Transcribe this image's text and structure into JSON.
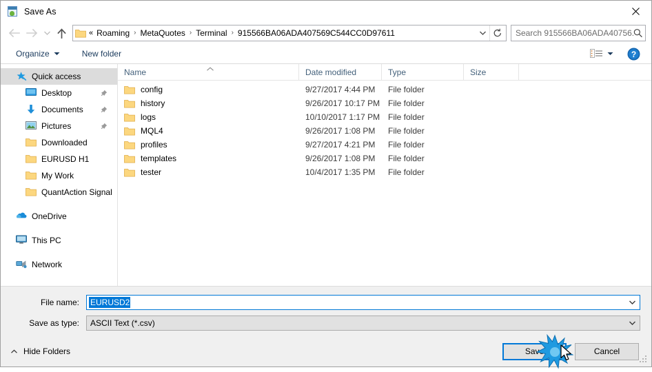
{
  "window": {
    "title": "Save As",
    "icon": "save-as-icon",
    "close_label": "✕"
  },
  "navigation": {
    "back_icon": "back-arrow-icon",
    "forward_icon": "forward-arrow-icon",
    "recent_icon": "recent-locations-icon",
    "up_icon": "up-arrow-icon",
    "breadcrumb_prefix": "«",
    "breadcrumbs": [
      "Roaming",
      "MetaQuotes",
      "Terminal",
      "915566BA06ADA407569C544CC0D97611"
    ],
    "separator": "›",
    "dropdown_icon": "chevron-down-icon",
    "refresh_icon": "refresh-icon"
  },
  "search": {
    "placeholder": "Search 915566BA06ADA40756...",
    "icon": "search-icon"
  },
  "toolbar": {
    "organize_label": "Organize",
    "organize_caret": "caret-down-icon",
    "new_folder_label": "New folder",
    "view_icon": "view-options-icon",
    "view_caret": "caret-down-icon",
    "help_icon": "help-icon",
    "help_glyph": "?"
  },
  "sidebar": {
    "groups": [
      {
        "items": [
          {
            "label": "Quick access",
            "icon": "star-pin-icon",
            "selected": true,
            "level": 0,
            "pinned": false
          },
          {
            "label": "Desktop",
            "icon": "desktop-icon",
            "selected": false,
            "level": 1,
            "pinned": true
          },
          {
            "label": "Documents",
            "icon": "documents-icon",
            "selected": false,
            "level": 1,
            "pinned": true
          },
          {
            "label": "Pictures",
            "icon": "pictures-icon",
            "selected": false,
            "level": 1,
            "pinned": true
          },
          {
            "label": "Downloaded",
            "icon": "folder-icon",
            "selected": false,
            "level": 1,
            "pinned": false
          },
          {
            "label": "EURUSD H1",
            "icon": "folder-icon",
            "selected": false,
            "level": 1,
            "pinned": false
          },
          {
            "label": "My Work",
            "icon": "folder-icon",
            "selected": false,
            "level": 1,
            "pinned": false
          },
          {
            "label": "QuantAction Signal",
            "icon": "folder-icon",
            "selected": false,
            "level": 1,
            "pinned": false
          }
        ]
      },
      {
        "items": [
          {
            "label": "OneDrive",
            "icon": "onedrive-icon",
            "selected": false,
            "level": 0,
            "pinned": false
          }
        ]
      },
      {
        "items": [
          {
            "label": "This PC",
            "icon": "this-pc-icon",
            "selected": false,
            "level": 0,
            "pinned": false
          }
        ]
      },
      {
        "items": [
          {
            "label": "Network",
            "icon": "network-icon",
            "selected": false,
            "level": 0,
            "pinned": false
          }
        ]
      }
    ]
  },
  "filelist": {
    "columns": [
      {
        "label": "Name",
        "key": "name"
      },
      {
        "label": "Date modified",
        "key": "date"
      },
      {
        "label": "Type",
        "key": "type"
      },
      {
        "label": "Size",
        "key": "size"
      }
    ],
    "sort_indicator": "sort-ascending-icon",
    "rows": [
      {
        "name": "config",
        "date": "9/27/2017 4:44 PM",
        "type": "File folder",
        "size": ""
      },
      {
        "name": "history",
        "date": "9/26/2017 10:17 PM",
        "type": "File folder",
        "size": ""
      },
      {
        "name": "logs",
        "date": "10/10/2017 1:17 PM",
        "type": "File folder",
        "size": ""
      },
      {
        "name": "MQL4",
        "date": "9/26/2017 1:08 PM",
        "type": "File folder",
        "size": ""
      },
      {
        "name": "profiles",
        "date": "9/27/2017 4:21 PM",
        "type": "File folder",
        "size": ""
      },
      {
        "name": "templates",
        "date": "9/26/2017 1:08 PM",
        "type": "File folder",
        "size": ""
      },
      {
        "name": "tester",
        "date": "10/4/2017 1:35 PM",
        "type": "File folder",
        "size": ""
      }
    ]
  },
  "form": {
    "filename_label": "File name:",
    "filename_value": "EURUSD2",
    "filetype_label": "Save as type:",
    "filetype_value": "ASCII Text (*.csv)",
    "dropdown_icon": "chevron-down-icon"
  },
  "footer": {
    "hide_folders_label": "Hide Folders",
    "hide_folders_icon": "caret-up-icon",
    "save_label": "Save",
    "cancel_label": "Cancel",
    "resize_grip": "resize-grip-icon"
  },
  "pointer": {
    "cursor_icon": "mouse-cursor-icon",
    "click_effect": "click-burst-icon"
  },
  "colors": {
    "accent": "#0078d7",
    "selection": "#0078d7",
    "folder": "#fcd77f",
    "header_text": "#44617b",
    "chrome": "#f0f0f0"
  }
}
